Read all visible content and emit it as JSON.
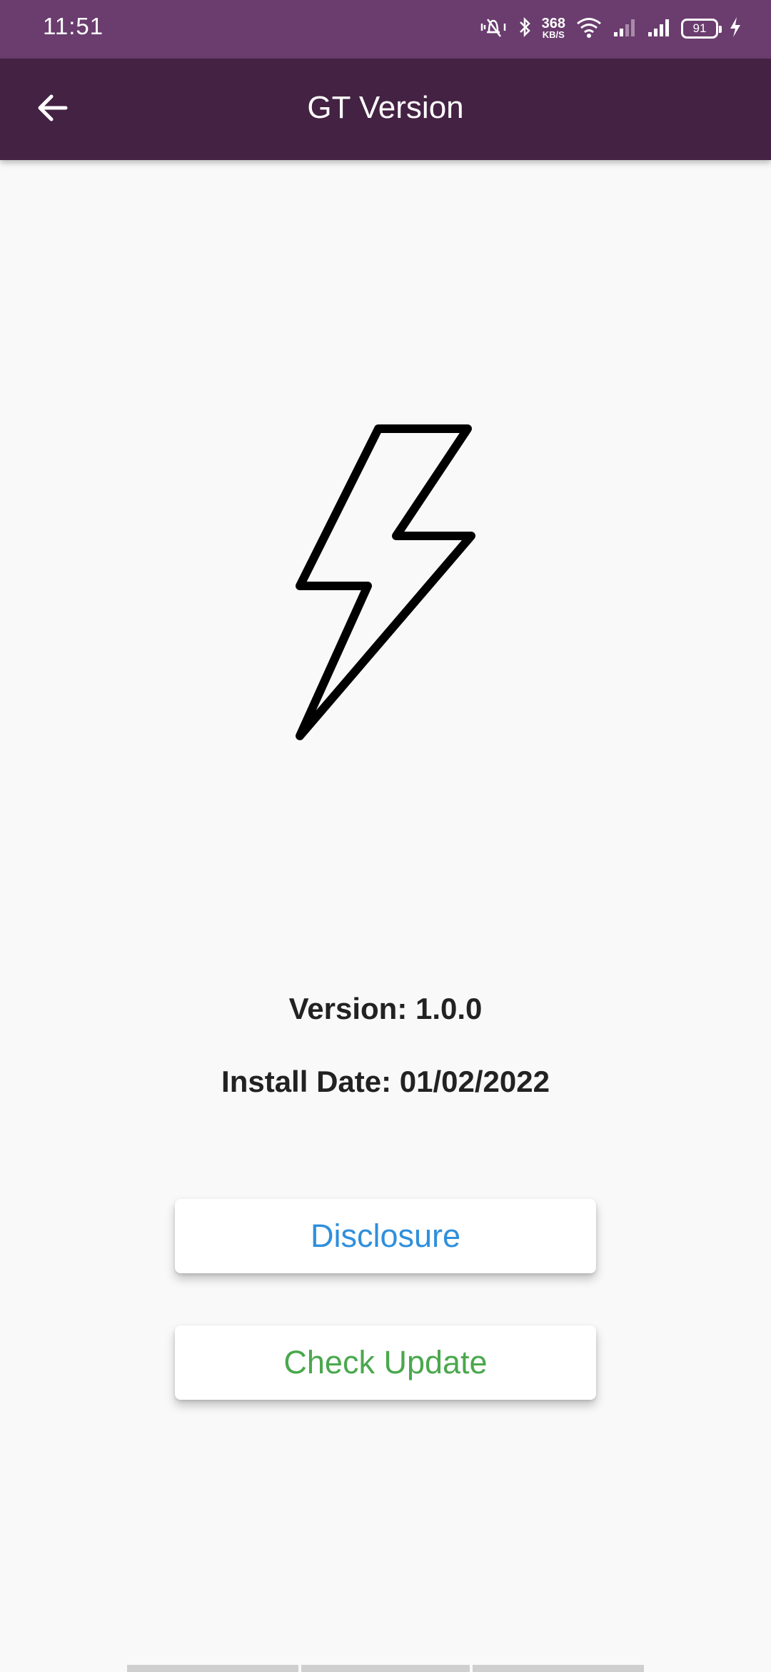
{
  "status_bar": {
    "time": "11:51",
    "net_speed_value": "368",
    "net_speed_unit": "KB/S",
    "battery_level": "91"
  },
  "app_bar": {
    "title": "GT Version"
  },
  "info": {
    "version": "Version: 1.0.0",
    "install_date": "Install Date: 01/02/2022"
  },
  "buttons": {
    "disclosure_label": "Disclosure",
    "check_update_label": "Check Update"
  },
  "colors": {
    "status_bar_bg": "#6a3d6e",
    "app_bar_bg": "#442243",
    "disclosure_text": "#2f8fdc",
    "check_update_text": "#4aa84d"
  },
  "icons": {
    "back": "arrow-left-icon",
    "logo": "lightning-bolt-icon"
  }
}
